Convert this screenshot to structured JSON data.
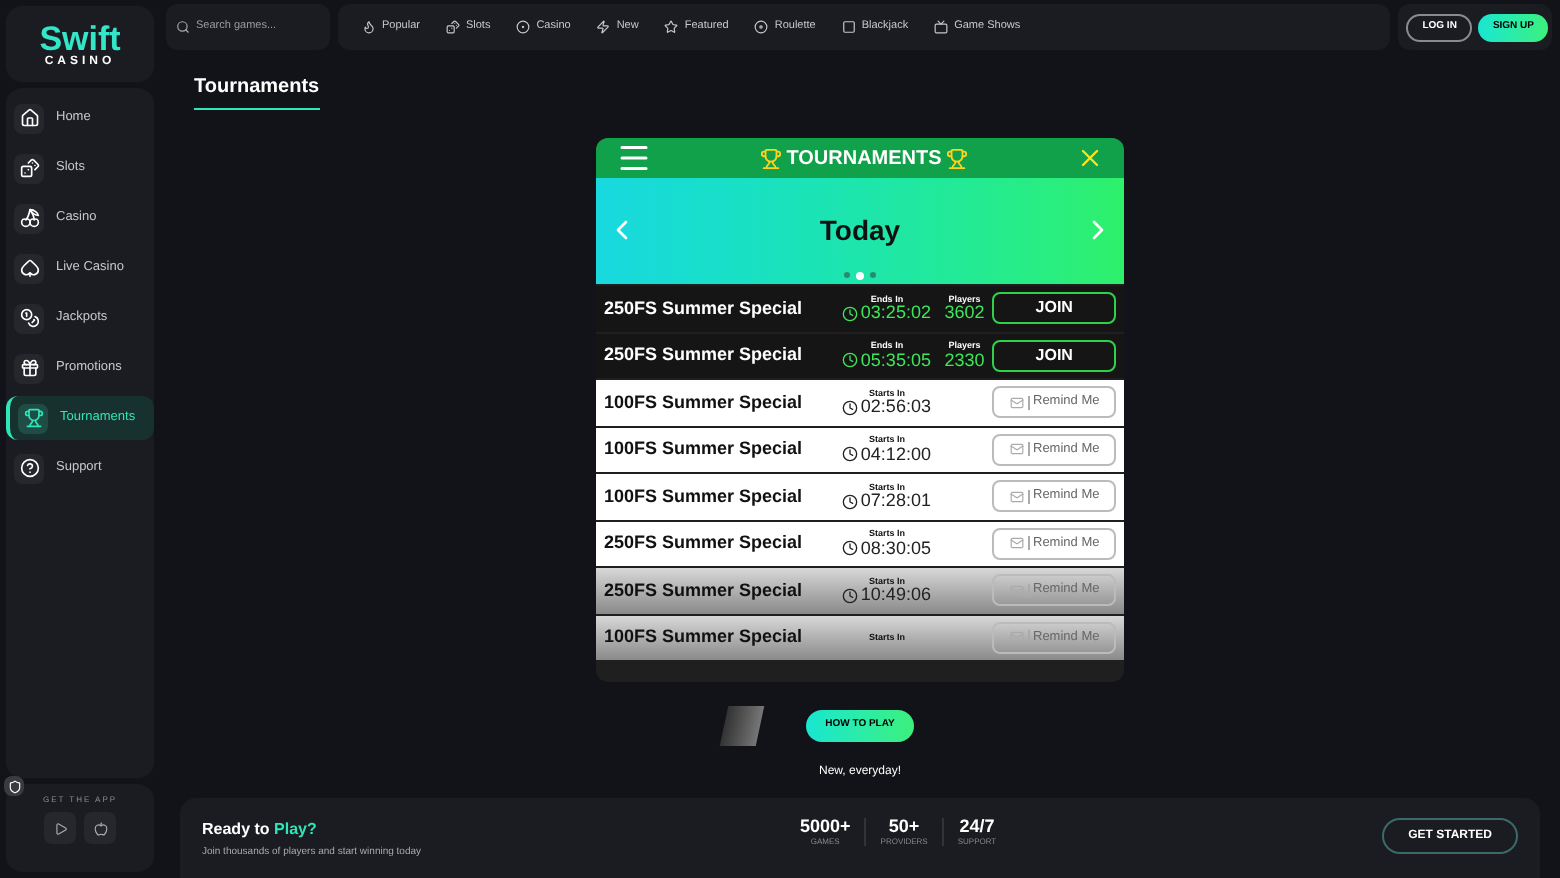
{
  "logo": {
    "line1": "Swift",
    "line2": "CASINO"
  },
  "sidebar": {
    "items": [
      {
        "label": "Home",
        "selected": false
      },
      {
        "label": "Slots",
        "selected": false
      },
      {
        "label": "Casino",
        "selected": false
      },
      {
        "label": "Live Casino",
        "selected": false
      },
      {
        "label": "Jackpots",
        "selected": false
      },
      {
        "label": "Promotions",
        "selected": false
      },
      {
        "label": "Tournaments",
        "selected": true
      },
      {
        "label": "Support",
        "selected": false
      }
    ],
    "app_label": "GET THE APP"
  },
  "search": {
    "placeholder": "Search games..."
  },
  "nav": [
    {
      "label": "Popular"
    },
    {
      "label": "Slots"
    },
    {
      "label": "Casino"
    },
    {
      "label": "New"
    },
    {
      "label": "Featured"
    },
    {
      "label": "Roulette"
    },
    {
      "label": "Blackjack"
    },
    {
      "label": "Game Shows"
    }
  ],
  "auth": {
    "login": "LOG IN",
    "signup": "SIGN UP"
  },
  "page_title": "Tournaments",
  "widget": {
    "title": "TOURNAMENTS",
    "banner": "Today",
    "dots": [
      {
        "selected": false
      },
      {
        "selected": true
      },
      {
        "selected": false
      }
    ],
    "rows": [
      {
        "kind": "live",
        "name": "250FS Summer Special",
        "timer_label": "Ends In",
        "timer": "03:25:02",
        "players_label": "Players",
        "players": "3602",
        "button": "JOIN",
        "faded": false
      },
      {
        "kind": "live",
        "name": "250FS Summer Special",
        "timer_label": "Ends In",
        "timer": "05:35:05",
        "players_label": "Players",
        "players": "2330",
        "button": "JOIN",
        "faded": false
      },
      {
        "kind": "upcoming",
        "name": "100FS Summer Special",
        "timer_label": "Starts In",
        "timer": "02:56:03",
        "button": "Remind Me",
        "faded": false
      },
      {
        "kind": "upcoming",
        "name": "100FS Summer Special",
        "timer_label": "Starts In",
        "timer": "04:12:00",
        "button": "Remind Me",
        "faded": false
      },
      {
        "kind": "upcoming",
        "name": "100FS Summer Special",
        "timer_label": "Starts In",
        "timer": "07:28:01",
        "button": "Remind Me",
        "faded": false
      },
      {
        "kind": "upcoming",
        "name": "250FS Summer Special",
        "timer_label": "Starts In",
        "timer": "08:30:05",
        "button": "Remind Me",
        "faded": false
      },
      {
        "kind": "upcoming",
        "name": "250FS Summer Special",
        "timer_label": "Starts In",
        "timer": "10:49:06",
        "button": "Remind Me",
        "faded": true
      },
      {
        "kind": "upcoming",
        "name": "100FS Summer Special",
        "timer_label": "Starts In",
        "button": "Remind Me",
        "faded": true
      }
    ]
  },
  "how_to_play": "HOW TO PLAY",
  "tagline": "New, everyday!",
  "cta": {
    "title": "Ready to",
    "title_highlight": "Play?",
    "subtitle": "Join thousands of players and start winning today",
    "stats": [
      {
        "value": "5000+",
        "label": "GAMES"
      },
      {
        "value": "50+",
        "label": "PROVIDERS"
      },
      {
        "value": "24/7",
        "label": "SUPPORT"
      }
    ],
    "button": "GET STARTED"
  }
}
